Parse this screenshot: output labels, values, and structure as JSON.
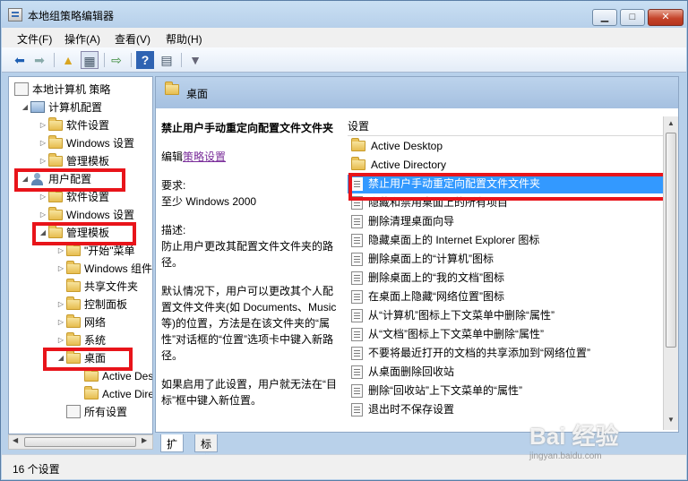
{
  "window": {
    "title": "本地组策略编辑器"
  },
  "menu": [
    "文件(F)",
    "操作(A)",
    "查看(V)",
    "帮助(H)"
  ],
  "tree": {
    "items": [
      {
        "label": "本地计算机 策略",
        "icon": "policy-icon"
      },
      {
        "label": "计算机配置",
        "icon": "computer-icon"
      },
      {
        "label": "软件设置",
        "icon": "folder-icon"
      },
      {
        "label": "Windows 设置",
        "icon": "folder-icon"
      },
      {
        "label": "管理模板",
        "icon": "folder-icon"
      },
      {
        "label": "用户配置",
        "icon": "user-icon"
      },
      {
        "label": "软件设置",
        "icon": "folder-icon"
      },
      {
        "label": "Windows 设置",
        "icon": "folder-icon"
      },
      {
        "label": "管理模板",
        "icon": "folder-icon"
      },
      {
        "label": "\"开始\"菜单",
        "icon": "folder-icon"
      },
      {
        "label": "Windows 组件",
        "icon": "folder-icon"
      },
      {
        "label": "共享文件夹",
        "icon": "folder-icon"
      },
      {
        "label": "控制面板",
        "icon": "folder-icon"
      },
      {
        "label": "网络",
        "icon": "folder-icon"
      },
      {
        "label": "系统",
        "icon": "folder-icon"
      },
      {
        "label": "桌面",
        "icon": "folder-icon"
      },
      {
        "label": "Active Desktop",
        "icon": "folder-icon"
      },
      {
        "label": "Active Directory",
        "icon": "folder-icon"
      },
      {
        "label": "所有设置",
        "icon": "settings-icon"
      }
    ]
  },
  "pane": {
    "header_title": "桌面",
    "description": {
      "policy_name": "禁止用户手动重定向配置文件文件夹",
      "edit_prefix": "编辑",
      "edit_link": "策略设置",
      "requirements_label": "要求:",
      "requirements": "至少 Windows 2000",
      "desc_label": "描述:",
      "desc_1": "防止用户更改其配置文件文件夹的路径。",
      "desc_2": "默认情况下，用户可以更改其个人配置文件文件夹(如 Documents、Music 等)的位置，方法是在该文件夹的“属性”对话框的“位置”选项卡中键入新路径。",
      "desc_3": "如果启用了此设置，用户就无法在“目标”框中键入新位置。"
    },
    "list_header": "设置",
    "list": [
      {
        "label": "Active Desktop",
        "icon": "folder-icon"
      },
      {
        "label": "Active Directory",
        "icon": "folder-icon"
      },
      {
        "label": "禁止用户手动重定向配置文件文件夹",
        "icon": "setting-icon"
      },
      {
        "label": "隐藏和禁用桌面上的所有项目",
        "icon": "setting-icon"
      },
      {
        "label": "删除清理桌面向导",
        "icon": "setting-icon"
      },
      {
        "label": "隐藏桌面上的 Internet Explorer 图标",
        "icon": "setting-icon"
      },
      {
        "label": "删除桌面上的“计算机”图标",
        "icon": "setting-icon"
      },
      {
        "label": "删除桌面上的“我的文档”图标",
        "icon": "setting-icon"
      },
      {
        "label": "在桌面上隐藏“网络位置”图标",
        "icon": "setting-icon"
      },
      {
        "label": "从“计算机”图标上下文菜单中删除“属性”",
        "icon": "setting-icon"
      },
      {
        "label": "从“文档”图标上下文菜单中删除“属性”",
        "icon": "setting-icon"
      },
      {
        "label": "不要将最近打开的文档的共享添加到“网络位置”",
        "icon": "setting-icon"
      },
      {
        "label": "从桌面删除回收站",
        "icon": "setting-icon"
      },
      {
        "label": "删除“回收站”上下文菜单的“属性”",
        "icon": "setting-icon"
      },
      {
        "label": "退出时不保存设置",
        "icon": "setting-icon"
      }
    ],
    "tabs": [
      "扩展",
      "标准"
    ]
  },
  "status": {
    "text": "16 个设置"
  },
  "watermark": {
    "brand": "Bai 经验",
    "url": "jingyan.baidu.com"
  },
  "colors": {
    "highlight_red": "#e8141a",
    "selection_blue": "#3399ff",
    "header_blue": "#bcd3ec"
  }
}
